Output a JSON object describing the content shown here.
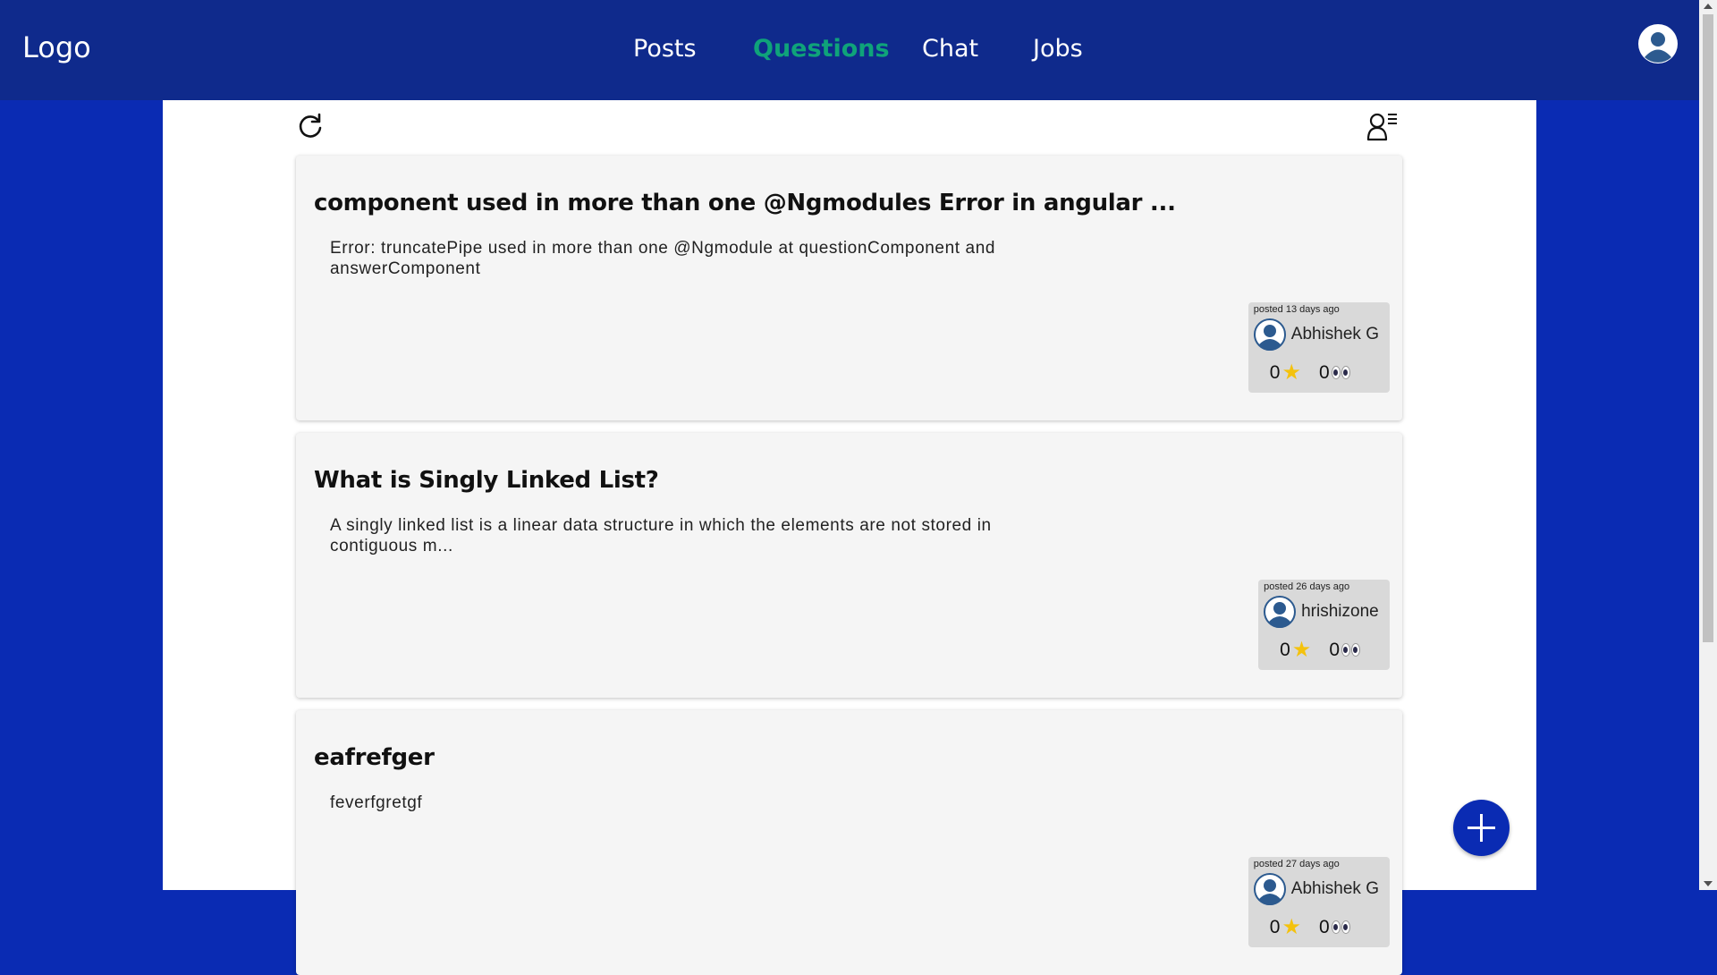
{
  "header": {
    "logo": "Logo",
    "nav": [
      "Posts",
      "Questions",
      "Chat",
      "Jobs"
    ],
    "active_nav": "Questions"
  },
  "toolbar": {
    "refresh_icon": "refresh-icon",
    "filter_icon": "user-list-filter-icon"
  },
  "questions": [
    {
      "title": "component used in more than one @Ngmodules Error in angular ...",
      "body": "Error: truncatePipe used in more than one @Ngmodule at questionComponent and answerComponent",
      "posted": "posted 13 days ago",
      "author": "Abhishek G",
      "stars": "0",
      "views": "0"
    },
    {
      "title": "What is Singly Linked List?",
      "body": "A singly linked list is a linear data structure in which the elements are not stored in contiguous m...",
      "posted": "posted 26 days ago",
      "author": "hrishizone",
      "stars": "0",
      "views": "0"
    },
    {
      "title": "eafrefger",
      "body": "feverfgretgf",
      "posted": "posted 27 days ago",
      "author": "Abhishek G",
      "stars": "0",
      "views": "0"
    }
  ],
  "colors": {
    "page_bg": "#0a2bb3",
    "navbar_bg": "#0f2a8c",
    "active_nav": "#0fa37a",
    "card_bg": "#f5f5f5",
    "meta_bg": "#d9d9d9",
    "star": "#f4c20d"
  },
  "fab_icon": "plus-icon"
}
